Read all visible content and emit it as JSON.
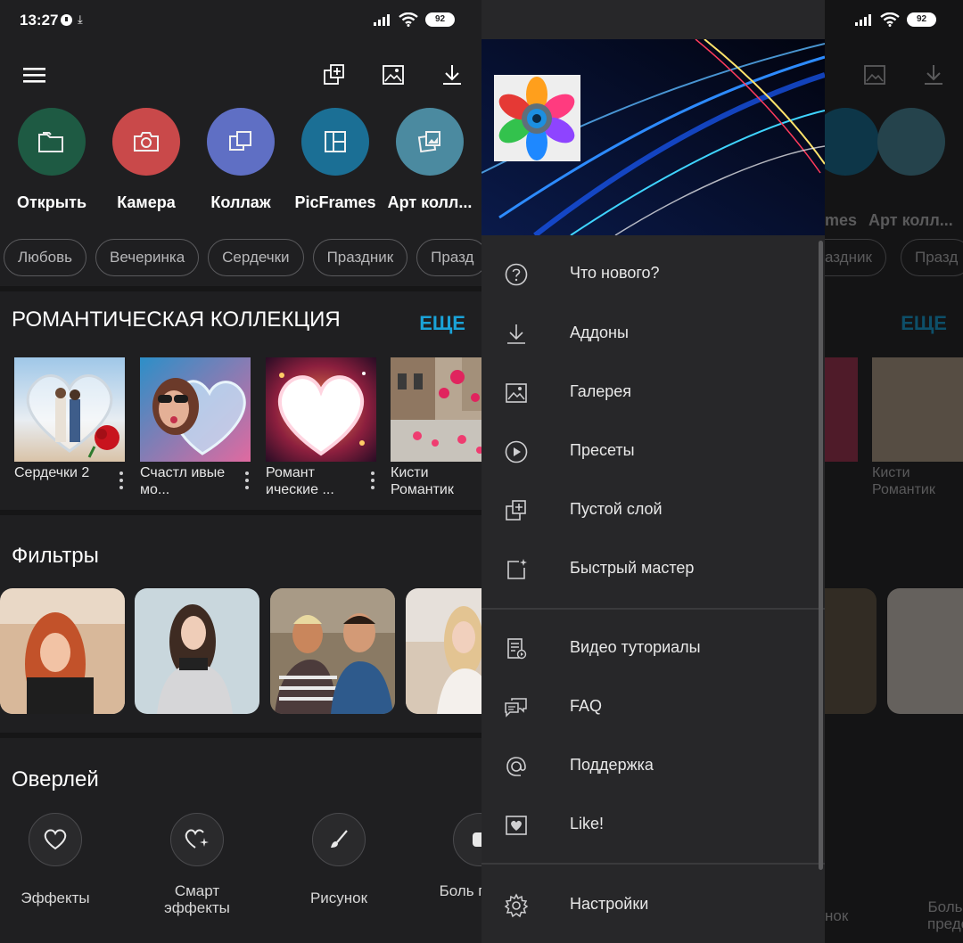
{
  "status_bar": {
    "time": "13:27",
    "battery": "92"
  },
  "quick_actions": [
    {
      "label": "Открыть",
      "color": "#1e5a43",
      "icon": "folder-icon"
    },
    {
      "label": "Камера",
      "color": "#c9494a",
      "icon": "camera-icon"
    },
    {
      "label": "Коллаж",
      "color": "#5f6fc4",
      "icon": "collage-icon"
    },
    {
      "label": "PicFrames",
      "color": "#1b6f95",
      "icon": "frames-icon"
    },
    {
      "label": "Арт колл...",
      "color": "#4b8aa0",
      "icon": "art-collage-icon"
    }
  ],
  "chips": [
    "Любовь",
    "Вечеринка",
    "Сердечки",
    "Праздник",
    "Празд"
  ],
  "romantic": {
    "title": "РОМАНТИЧЕСКАЯ КОЛЛЕКЦИЯ",
    "more": "ЕЩЕ",
    "cards": [
      {
        "title": "Сердечки 2"
      },
      {
        "title": "Счастл ивые мо..."
      },
      {
        "title": "Романт ические ..."
      },
      {
        "title": "Кисти Романтик"
      }
    ]
  },
  "filters": {
    "title": "Фильтры"
  },
  "overlay": {
    "title": "Оверлей",
    "items": [
      {
        "label": "Эффекты",
        "icon": "heart-icon"
      },
      {
        "label": "Смарт эффекты",
        "icon": "smart-heart-icon"
      },
      {
        "label": "Рисунок",
        "icon": "brush-icon"
      },
      {
        "label": "Боль преде",
        "icon": "more-effects-icon"
      }
    ]
  },
  "right_partial": {
    "qa_label_1": "mes",
    "qa_label_2": "Арт колл...",
    "chip_1": "аздник",
    "chip_2": "Празд",
    "card_title": "Кисти Романтик",
    "ov_label_1": "нок",
    "ov_label_2": "Боль преде"
  },
  "drawer": {
    "items": [
      {
        "label": "Что нового?",
        "icon": "help-icon"
      },
      {
        "label": "Аддоны",
        "icon": "download-icon"
      },
      {
        "label": "Галерея",
        "icon": "gallery-icon"
      },
      {
        "label": "Пресеты",
        "icon": "play-icon"
      },
      {
        "label": "Пустой слой",
        "icon": "add-layer-icon"
      },
      {
        "label": "Быстрый мастер",
        "icon": "quick-master-icon"
      }
    ],
    "secondary": [
      {
        "label": "Видео туториалы",
        "icon": "video-tutorial-icon"
      },
      {
        "label": "FAQ",
        "icon": "faq-icon"
      },
      {
        "label": "Поддержка",
        "icon": "at-icon"
      },
      {
        "label": "Like!",
        "icon": "like-icon"
      }
    ],
    "settings": {
      "label": "Настройки",
      "icon": "settings-icon"
    }
  },
  "colors": {
    "accent": "#1aa3d8",
    "background": "#1f1f21",
    "drawer": "#272729"
  }
}
